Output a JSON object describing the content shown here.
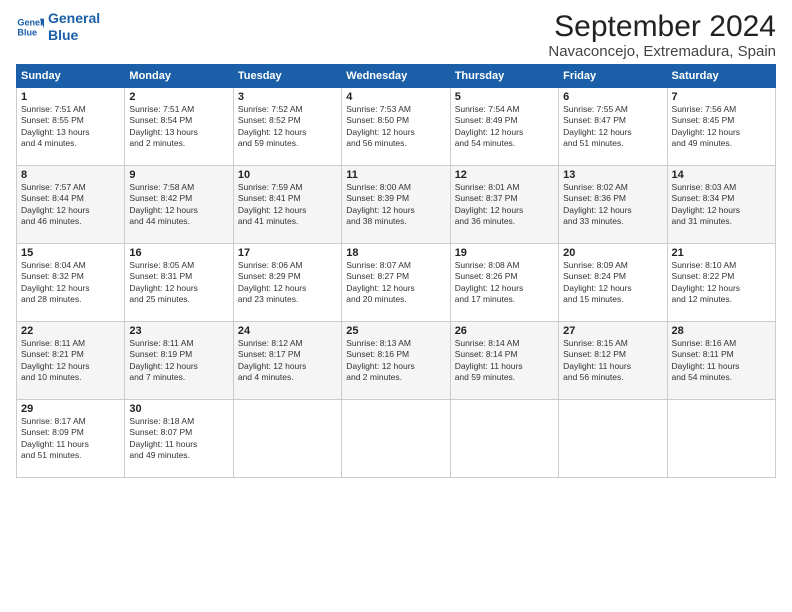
{
  "header": {
    "logo_line1": "General",
    "logo_line2": "Blue",
    "title": "September 2024",
    "subtitle": "Navaconcejo, Extremadura, Spain"
  },
  "days_of_week": [
    "Sunday",
    "Monday",
    "Tuesday",
    "Wednesday",
    "Thursday",
    "Friday",
    "Saturday"
  ],
  "weeks": [
    [
      {
        "day": "1",
        "info": "Sunrise: 7:51 AM\nSunset: 8:55 PM\nDaylight: 13 hours\nand 4 minutes."
      },
      {
        "day": "2",
        "info": "Sunrise: 7:51 AM\nSunset: 8:54 PM\nDaylight: 13 hours\nand 2 minutes."
      },
      {
        "day": "3",
        "info": "Sunrise: 7:52 AM\nSunset: 8:52 PM\nDaylight: 12 hours\nand 59 minutes."
      },
      {
        "day": "4",
        "info": "Sunrise: 7:53 AM\nSunset: 8:50 PM\nDaylight: 12 hours\nand 56 minutes."
      },
      {
        "day": "5",
        "info": "Sunrise: 7:54 AM\nSunset: 8:49 PM\nDaylight: 12 hours\nand 54 minutes."
      },
      {
        "day": "6",
        "info": "Sunrise: 7:55 AM\nSunset: 8:47 PM\nDaylight: 12 hours\nand 51 minutes."
      },
      {
        "day": "7",
        "info": "Sunrise: 7:56 AM\nSunset: 8:45 PM\nDaylight: 12 hours\nand 49 minutes."
      }
    ],
    [
      {
        "day": "8",
        "info": "Sunrise: 7:57 AM\nSunset: 8:44 PM\nDaylight: 12 hours\nand 46 minutes."
      },
      {
        "day": "9",
        "info": "Sunrise: 7:58 AM\nSunset: 8:42 PM\nDaylight: 12 hours\nand 44 minutes."
      },
      {
        "day": "10",
        "info": "Sunrise: 7:59 AM\nSunset: 8:41 PM\nDaylight: 12 hours\nand 41 minutes."
      },
      {
        "day": "11",
        "info": "Sunrise: 8:00 AM\nSunset: 8:39 PM\nDaylight: 12 hours\nand 38 minutes."
      },
      {
        "day": "12",
        "info": "Sunrise: 8:01 AM\nSunset: 8:37 PM\nDaylight: 12 hours\nand 36 minutes."
      },
      {
        "day": "13",
        "info": "Sunrise: 8:02 AM\nSunset: 8:36 PM\nDaylight: 12 hours\nand 33 minutes."
      },
      {
        "day": "14",
        "info": "Sunrise: 8:03 AM\nSunset: 8:34 PM\nDaylight: 12 hours\nand 31 minutes."
      }
    ],
    [
      {
        "day": "15",
        "info": "Sunrise: 8:04 AM\nSunset: 8:32 PM\nDaylight: 12 hours\nand 28 minutes."
      },
      {
        "day": "16",
        "info": "Sunrise: 8:05 AM\nSunset: 8:31 PM\nDaylight: 12 hours\nand 25 minutes."
      },
      {
        "day": "17",
        "info": "Sunrise: 8:06 AM\nSunset: 8:29 PM\nDaylight: 12 hours\nand 23 minutes."
      },
      {
        "day": "18",
        "info": "Sunrise: 8:07 AM\nSunset: 8:27 PM\nDaylight: 12 hours\nand 20 minutes."
      },
      {
        "day": "19",
        "info": "Sunrise: 8:08 AM\nSunset: 8:26 PM\nDaylight: 12 hours\nand 17 minutes."
      },
      {
        "day": "20",
        "info": "Sunrise: 8:09 AM\nSunset: 8:24 PM\nDaylight: 12 hours\nand 15 minutes."
      },
      {
        "day": "21",
        "info": "Sunrise: 8:10 AM\nSunset: 8:22 PM\nDaylight: 12 hours\nand 12 minutes."
      }
    ],
    [
      {
        "day": "22",
        "info": "Sunrise: 8:11 AM\nSunset: 8:21 PM\nDaylight: 12 hours\nand 10 minutes."
      },
      {
        "day": "23",
        "info": "Sunrise: 8:11 AM\nSunset: 8:19 PM\nDaylight: 12 hours\nand 7 minutes."
      },
      {
        "day": "24",
        "info": "Sunrise: 8:12 AM\nSunset: 8:17 PM\nDaylight: 12 hours\nand 4 minutes."
      },
      {
        "day": "25",
        "info": "Sunrise: 8:13 AM\nSunset: 8:16 PM\nDaylight: 12 hours\nand 2 minutes."
      },
      {
        "day": "26",
        "info": "Sunrise: 8:14 AM\nSunset: 8:14 PM\nDaylight: 11 hours\nand 59 minutes."
      },
      {
        "day": "27",
        "info": "Sunrise: 8:15 AM\nSunset: 8:12 PM\nDaylight: 11 hours\nand 56 minutes."
      },
      {
        "day": "28",
        "info": "Sunrise: 8:16 AM\nSunset: 8:11 PM\nDaylight: 11 hours\nand 54 minutes."
      }
    ],
    [
      {
        "day": "29",
        "info": "Sunrise: 8:17 AM\nSunset: 8:09 PM\nDaylight: 11 hours\nand 51 minutes."
      },
      {
        "day": "30",
        "info": "Sunrise: 8:18 AM\nSunset: 8:07 PM\nDaylight: 11 hours\nand 49 minutes."
      },
      {
        "day": "",
        "info": ""
      },
      {
        "day": "",
        "info": ""
      },
      {
        "day": "",
        "info": ""
      },
      {
        "day": "",
        "info": ""
      },
      {
        "day": "",
        "info": ""
      }
    ]
  ]
}
